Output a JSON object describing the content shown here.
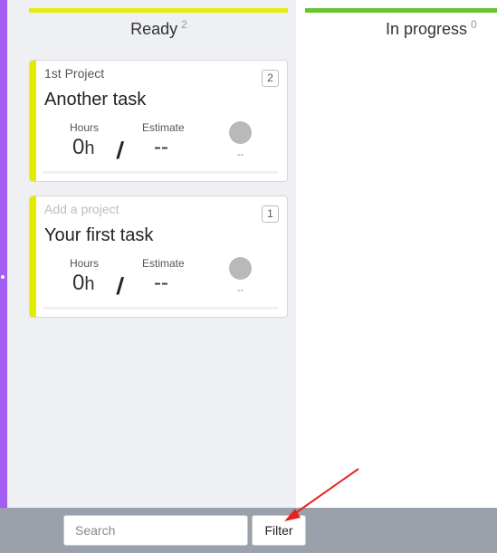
{
  "columns": [
    {
      "title": "Ready",
      "count": "2",
      "color": "#e8ec0c"
    },
    {
      "title": "In progress",
      "count": "0",
      "color": "#66c72c"
    }
  ],
  "cards": [
    {
      "project": "1st Project",
      "project_is_placeholder": false,
      "title": "Another task",
      "badge": "2",
      "hours_label": "Hours",
      "hours_value": "0",
      "hours_unit": "h",
      "separator": "/",
      "estimate_label": "Estimate",
      "estimate_value": "--",
      "assignee": "--",
      "accent_color": "#e4ea00"
    },
    {
      "project": "Add a project",
      "project_is_placeholder": true,
      "title": "Your first task",
      "badge": "1",
      "hours_label": "Hours",
      "hours_value": "0",
      "hours_unit": "h",
      "separator": "/",
      "estimate_label": "Estimate",
      "estimate_value": "--",
      "assignee": "--",
      "accent_color": "#e4ea00"
    }
  ],
  "bottombar": {
    "search_placeholder": "Search",
    "search_value": "",
    "filter_label": "Filter"
  },
  "sidebar": {
    "color": "#a15ef0",
    "toggle_icon": "chevron-right-icon"
  },
  "annotation": {
    "type": "arrow",
    "color": "#e8231c",
    "target": "filter-button"
  }
}
